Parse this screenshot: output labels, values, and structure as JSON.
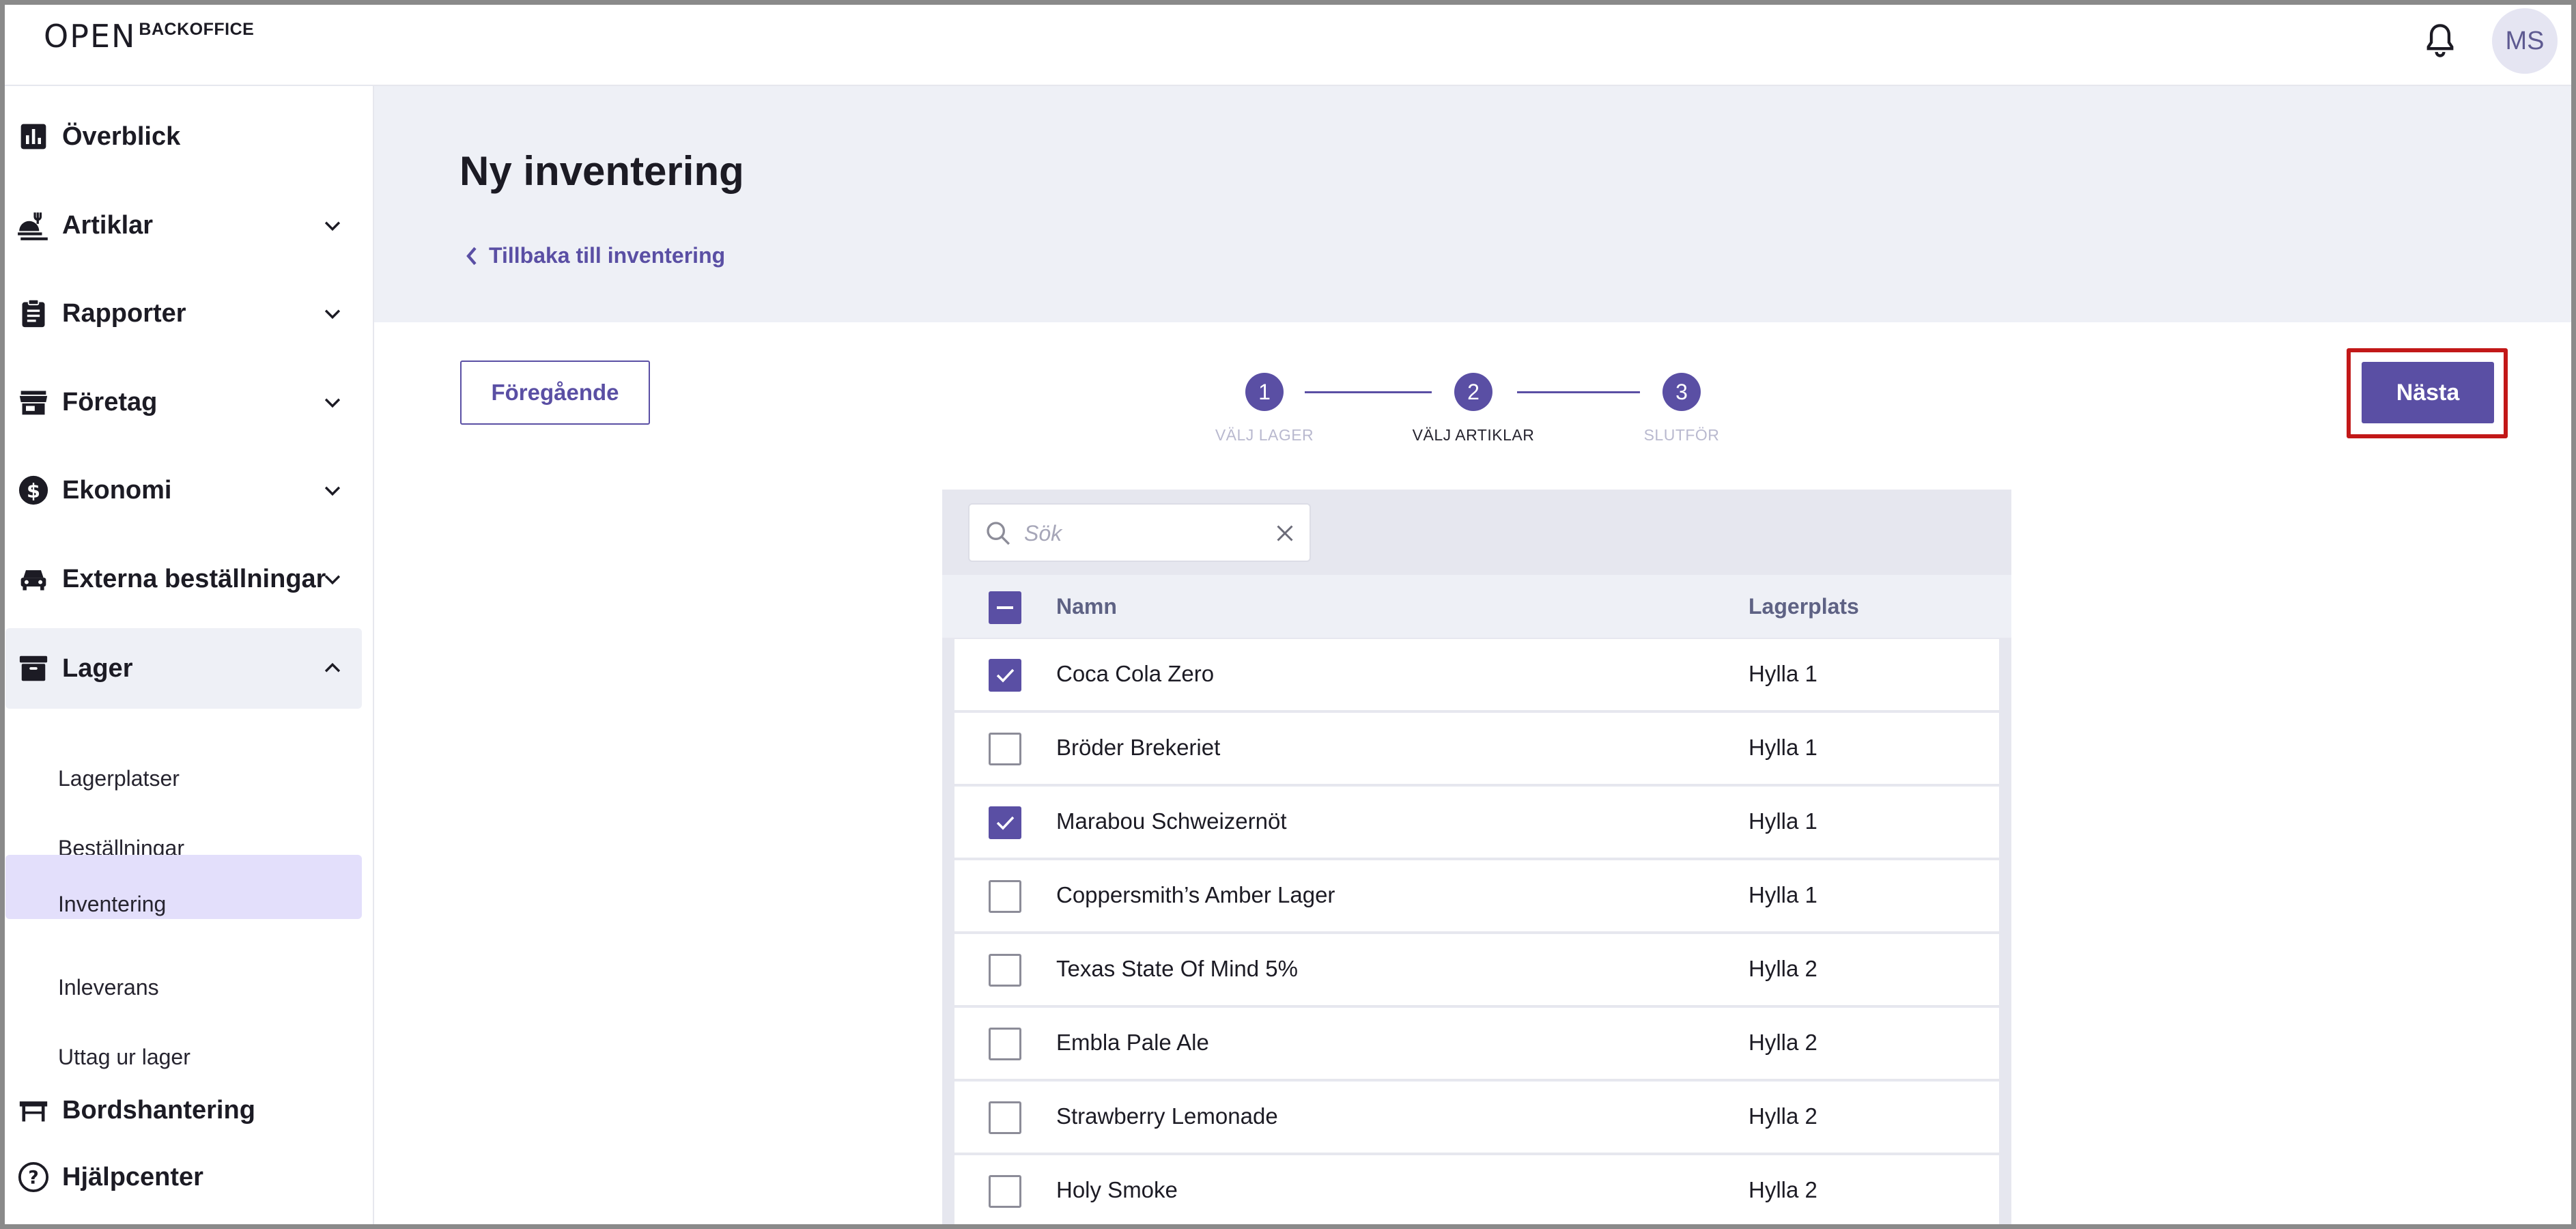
{
  "header": {
    "logo_mark": "OPEN",
    "logo_text": "BACKOFFICE",
    "avatar_initials": "MS"
  },
  "sidebar": {
    "items": [
      {
        "label": "Överblick",
        "icon": "bar-chart-icon",
        "expandable": false
      },
      {
        "label": "Artiklar",
        "icon": "food-service-icon",
        "expandable": true
      },
      {
        "label": "Rapporter",
        "icon": "clipboard-icon",
        "expandable": true
      },
      {
        "label": "Företag",
        "icon": "storefront-icon",
        "expandable": true
      },
      {
        "label": "Ekonomi",
        "icon": "dollar-icon",
        "expandable": true
      },
      {
        "label": "Externa beställningar",
        "icon": "car-icon",
        "expandable": true
      },
      {
        "label": "Lager",
        "icon": "archive-icon",
        "expandable": true,
        "expanded": true
      }
    ],
    "lager_sub": [
      "Lagerplatser",
      "Beställningar",
      "Inventering",
      "Inleverans",
      "Uttag ur lager"
    ],
    "selected_sub": "Inventering",
    "bottom_items": [
      {
        "label": "Bordshantering",
        "icon": "table-icon"
      },
      {
        "label": "Hjälpcenter",
        "icon": "help-icon"
      }
    ]
  },
  "main": {
    "title": "Ny inventering",
    "back_link": "Tillbaka till inventering",
    "prev_button": "Föregående",
    "next_button": "Nästa"
  },
  "stepper": {
    "steps": [
      {
        "number": "1",
        "label": "VÄLJ LAGER",
        "state": "done"
      },
      {
        "number": "2",
        "label": "VÄLJ ARTIKLAR",
        "state": "current"
      },
      {
        "number": "3",
        "label": "SLUTFÖR",
        "state": "upcoming"
      }
    ]
  },
  "search": {
    "placeholder": "Sök",
    "value": ""
  },
  "table": {
    "columns": [
      "Namn",
      "Lagerplats"
    ],
    "select_all_state": "indeterminate",
    "rows": [
      {
        "name": "Coca Cola Zero",
        "location": "Hylla 1",
        "checked": true
      },
      {
        "name": "Bröder Brekeriet",
        "location": "Hylla 1",
        "checked": false
      },
      {
        "name": "Marabou Schweizernöt",
        "location": "Hylla 1",
        "checked": true
      },
      {
        "name": "Coppersmith’s Amber Lager",
        "location": "Hylla 1",
        "checked": false
      },
      {
        "name": "Texas State Of Mind 5%",
        "location": "Hylla 2",
        "checked": false
      },
      {
        "name": "Embla Pale Ale",
        "location": "Hylla 2",
        "checked": false
      },
      {
        "name": "Strawberry Lemonade",
        "location": "Hylla 2",
        "checked": false
      },
      {
        "name": "Holy Smoke",
        "location": "Hylla 2",
        "checked": false
      }
    ]
  },
  "colors": {
    "accent": "#5a4fa4",
    "header_bg": "#eef0f6",
    "selected_nav_bg": "#e3dffb",
    "highlight_border": "#c21818"
  }
}
